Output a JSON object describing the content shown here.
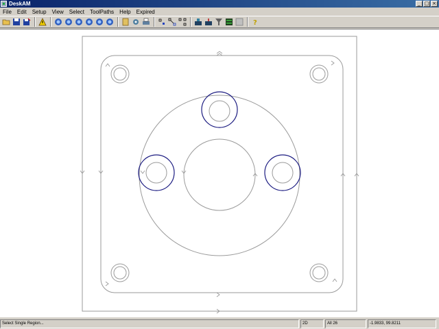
{
  "window": {
    "title": "DeskAM"
  },
  "menus": [
    "File",
    "Edit",
    "Setup",
    "View",
    "Select",
    "ToolPaths",
    "Help",
    "Expired"
  ],
  "toolbar": {
    "groups": [
      [
        "open-folder-icon",
        "save-icon",
        "save-as-icon"
      ],
      [
        "warning-icon"
      ],
      [
        "zoom-in-icon",
        "zoom-out-icon",
        "zoom-window-icon",
        "zoom-all-icon",
        "zoom-previous-icon",
        "zoom-fit-icon"
      ],
      [
        "import-icon",
        "settings-icon",
        "print-icon"
      ],
      [
        "select-point-icon",
        "select-region-icon",
        "select-chain-icon"
      ],
      [
        "toolpath-machine-icon",
        "toolpath-simulate-icon",
        "filter-icon",
        "layer-icon",
        "grid-icon"
      ],
      [
        "help-icon"
      ]
    ]
  },
  "status": {
    "message": "Select Single Region...",
    "mode": "2D",
    "selection": "All 26",
    "coords": "-1.9833, 99.8211"
  },
  "colors": {
    "geometry": "#9a9a9a",
    "selected": "#1a1a80",
    "canvas": "#ffffff"
  }
}
